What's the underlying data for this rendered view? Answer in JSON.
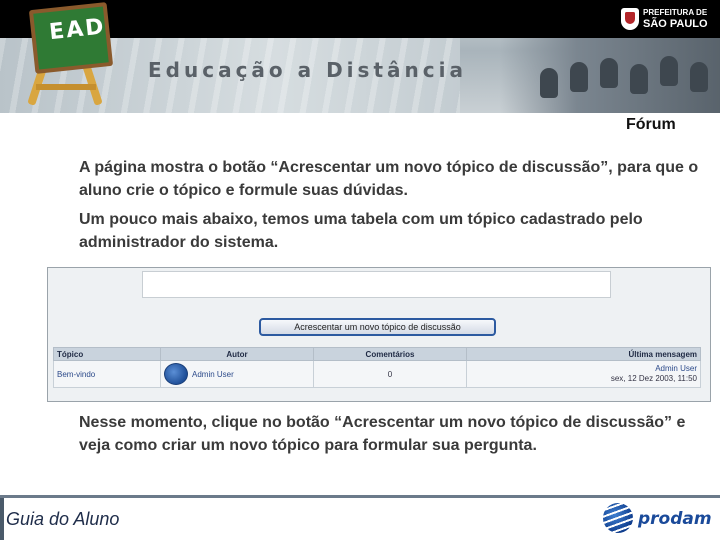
{
  "banner": {
    "title": "Educação a Distância",
    "logo_text": "EAD",
    "prefeitura_line1": "PREFEITURA DE",
    "prefeitura_line2": "SÃO PAULO"
  },
  "section_title": "Fórum",
  "paragraphs": [
    "A página mostra o botão “Acrescentar um novo tópico de discussão”, para que o aluno crie o tópico e formule suas dúvidas.",
    "Um pouco mais abaixo, temos uma tabela com um tópico cadastrado pelo administrador do sistema.",
    "Nesse momento, clique no botão “Acrescentar um novo tópico de discussão” e veja como criar um novo tópico para formular sua pergunta."
  ],
  "screenshot": {
    "button_label": "Acrescentar um novo tópico de discussão",
    "table": {
      "headers": [
        "Tópico",
        "Autor",
        "Comentários",
        "Última mensagem"
      ],
      "row": {
        "topico": "Bem-vindo",
        "autor": "Admin User",
        "comentarios": "0",
        "ultima_autor": "Admin User",
        "ultima_data": "sex, 12 Dez 2003, 11:50"
      }
    }
  },
  "footer": {
    "label": "Guia do Aluno",
    "brand": "prodam"
  },
  "colors": {
    "accent": "#2c5aa0",
    "banner_bar": "#000000",
    "footer_rule": "#6b7a8a"
  },
  "icons": [
    "ead-chalkboard-icon",
    "prefeitura-crest-icon",
    "user-avatar-icon",
    "prodam-globe-icon"
  ]
}
